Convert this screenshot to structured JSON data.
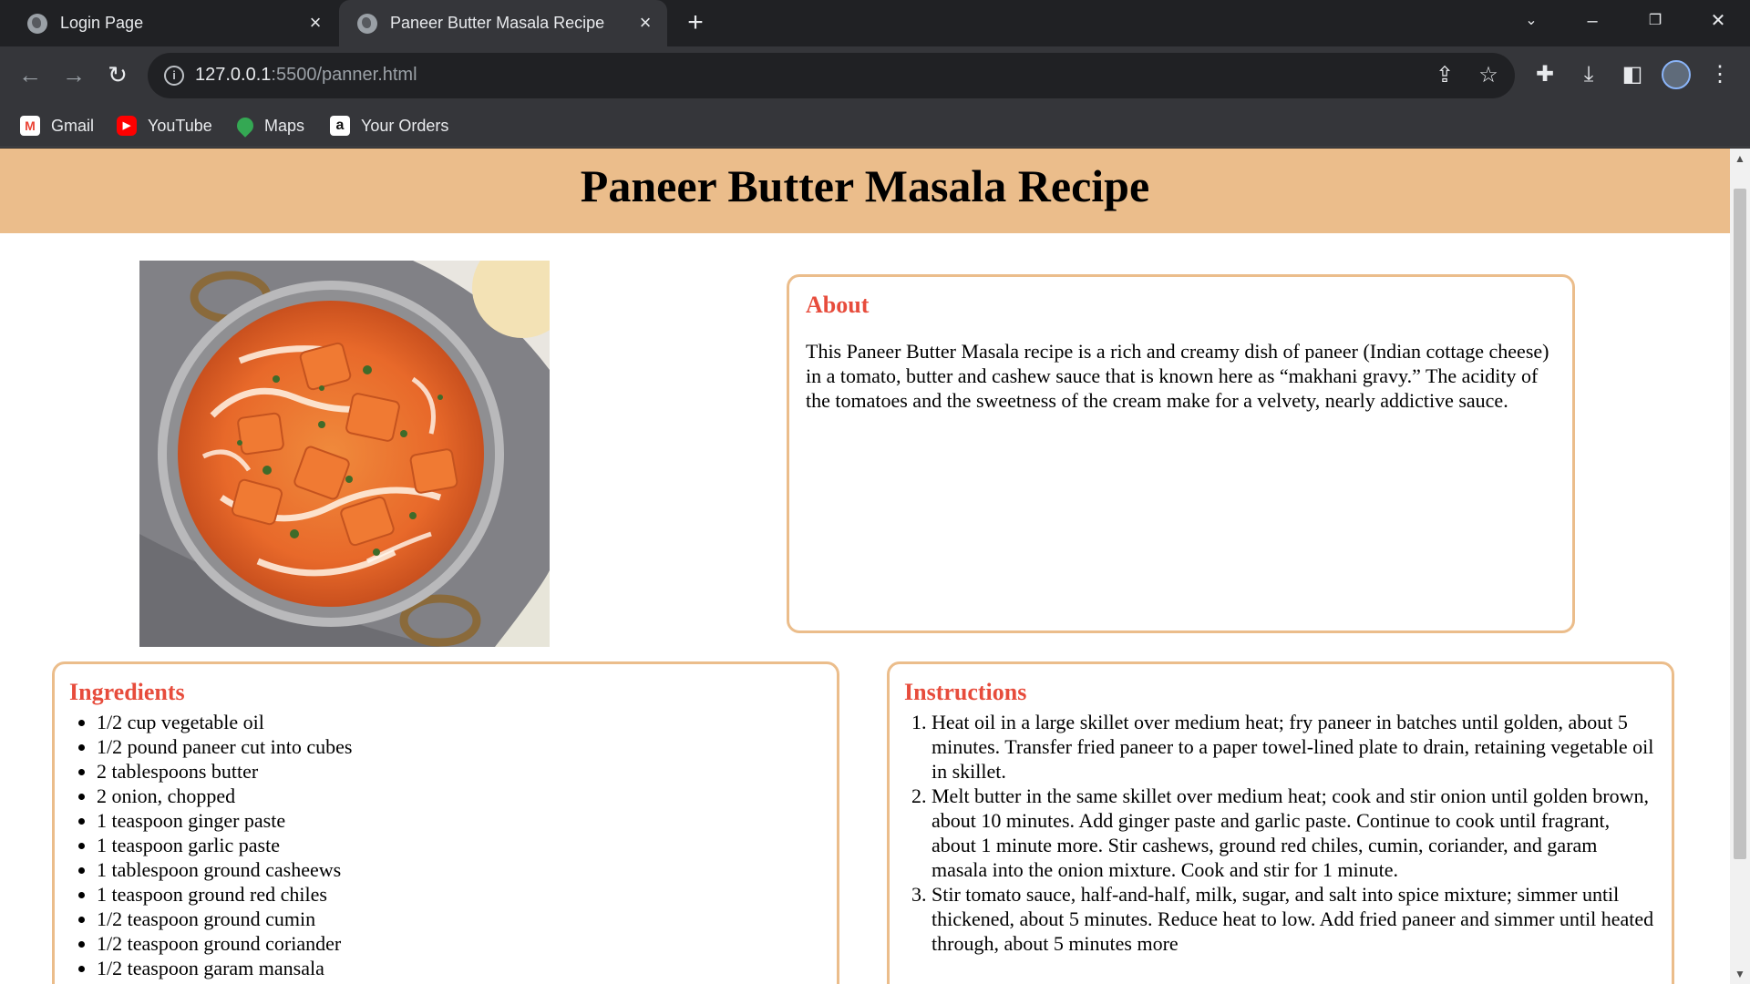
{
  "browser": {
    "tabs": [
      {
        "title": "Login Page",
        "active": false
      },
      {
        "title": "Paneer Butter Masala Recipe",
        "active": true
      }
    ],
    "address": {
      "host": "127.0.0.1",
      "path": ":5500/panner.html"
    },
    "bookmarks": [
      {
        "label": "Gmail",
        "icon": "gmail-icon"
      },
      {
        "label": "YouTube",
        "icon": "youtube-icon"
      },
      {
        "label": "Maps",
        "icon": "maps-icon"
      },
      {
        "label": "Your Orders",
        "icon": "amazon-icon"
      }
    ]
  },
  "page": {
    "title": "Paneer Butter Masala Recipe",
    "colors": {
      "header_bg": "#ebbd8b",
      "card_border": "#ebbd8b",
      "heading": "#e74c3c"
    },
    "image": {
      "alt": "paneer-butter-masala-photo"
    },
    "about": {
      "heading": "About",
      "text": "This Paneer Butter Masala recipe is a rich and creamy dish of paneer (Indian cottage cheese) in a tomato, butter and cashew sauce that is known here as “makhani gravy.” The acidity of the tomatoes and the sweetness of the cream make for a velvety, nearly addictive sauce."
    },
    "ingredients": {
      "heading": "Ingredients",
      "items": [
        "1/2 cup vegetable oil",
        "1/2 pound paneer cut into cubes",
        "2 tablespoons butter",
        "2 onion, chopped",
        "1 teaspoon ginger paste",
        "1 teaspoon garlic paste",
        "1 tablespoon ground casheews",
        "1 teaspoon ground red chiles",
        "1/2 teaspoon ground cumin",
        "1/2 teaspoon ground coriander",
        "1/2 teaspoon garam mansala"
      ]
    },
    "instructions": {
      "heading": "Instructions",
      "steps": [
        "Heat oil in a large skillet over medium heat; fry paneer in batches until golden, about 5 minutes. Transfer fried paneer to a paper towel-lined plate to drain, retaining vegetable oil in skillet.",
        "Melt butter in the same skillet over medium heat; cook and stir onion until golden brown, about 10 minutes. Add ginger paste and garlic paste. Continue to cook until fragrant, about 1 minute more. Stir cashews, ground red chiles, cumin, coriander, and garam masala into the onion mixture. Cook and stir for 1 minute.",
        "Stir tomato sauce, half-and-half, milk, sugar, and salt into spice mixture; simmer until thickened, about 5 minutes. Reduce heat to low. Add fried paneer and simmer until heated through, about 5 minutes more"
      ]
    }
  }
}
